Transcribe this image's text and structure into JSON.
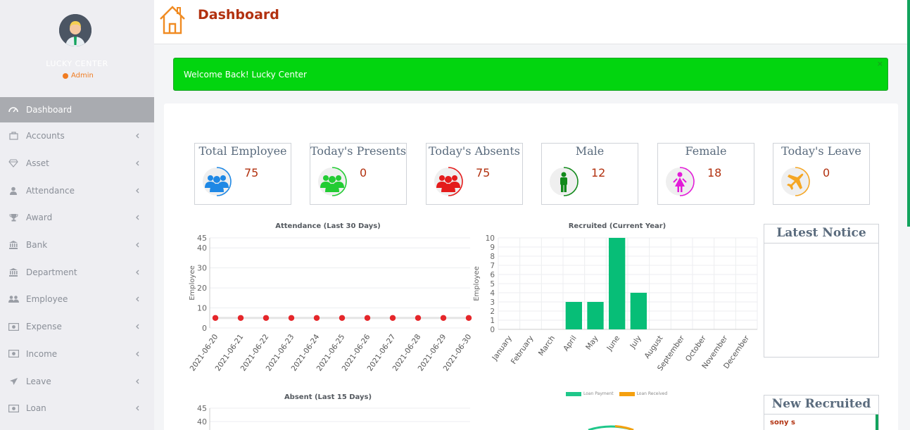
{
  "sidebar": {
    "user_name": "LUCKY CENTER",
    "user_role": "Admin",
    "items": [
      {
        "label": "Dashboard",
        "icon": "dashboard-icon",
        "active": true
      },
      {
        "label": "Accounts",
        "icon": "briefcase-icon"
      },
      {
        "label": "Asset",
        "icon": "diamond-icon"
      },
      {
        "label": "Attendance",
        "icon": "user-icon"
      },
      {
        "label": "Award",
        "icon": "trophy-icon"
      },
      {
        "label": "Bank",
        "icon": "bank-icon"
      },
      {
        "label": "Department",
        "icon": "bank-icon"
      },
      {
        "label": "Employee",
        "icon": "users-icon"
      },
      {
        "label": "Expense",
        "icon": "money-icon"
      },
      {
        "label": "Income",
        "icon": "money-icon"
      },
      {
        "label": "Leave",
        "icon": "plane-icon"
      },
      {
        "label": "Loan",
        "icon": "money-icon"
      }
    ]
  },
  "header": {
    "title": "Dashboard"
  },
  "alert": {
    "message": "Welcome Back! Lucky Center",
    "close": "×"
  },
  "stats": [
    {
      "title": "Total Employee",
      "value": "75",
      "color": "#1e88e5",
      "icon": "users-icon"
    },
    {
      "title": "Today's Presents",
      "value": "0",
      "color": "#22cc33",
      "icon": "users-icon"
    },
    {
      "title": "Today's Absents",
      "value": "75",
      "color": "#e41b1b",
      "icon": "users-icon"
    },
    {
      "title": "Male",
      "value": "12",
      "color": "#128a1b",
      "icon": "male-icon"
    },
    {
      "title": "Female",
      "value": "18",
      "color": "#e21cd8",
      "icon": "female-icon"
    },
    {
      "title": "Today's Leave",
      "value": "0",
      "color": "#f5a623",
      "icon": "plane-icon"
    }
  ],
  "notice": {
    "title": "Latest Notice"
  },
  "recruited_box": {
    "title": "New Recruited",
    "items": [
      "sony s"
    ]
  },
  "legend": {
    "items": [
      {
        "label": "Loan Payment",
        "color": "#1fc78a"
      },
      {
        "label": "Loan Received",
        "color": "#f5a00f"
      }
    ]
  },
  "chart_data": [
    {
      "type": "line",
      "title": "Attendance (Last 30 Days)",
      "ylabel": "Employee",
      "ylim": [
        0,
        45
      ],
      "yticks": [
        0,
        10,
        20,
        30,
        40,
        45
      ],
      "x": [
        "2021-06-20",
        "2021-06-21",
        "2021-06-22",
        "2021-06-23",
        "2021-06-24",
        "2021-06-25",
        "2021-06-26",
        "2021-06-27",
        "2021-06-28",
        "2021-06-29",
        "2021-06-30"
      ],
      "values": [
        5,
        5,
        5,
        5,
        5,
        5,
        5,
        5,
        5,
        5,
        5
      ],
      "color": "#e5262a"
    },
    {
      "type": "bar",
      "title": "Recruited (Current Year)",
      "ylabel": "Employee",
      "ylim": [
        0,
        10
      ],
      "yticks": [
        0,
        1,
        2,
        3,
        4,
        5,
        6,
        7,
        8,
        9,
        10
      ],
      "categories": [
        "January",
        "February",
        "March",
        "April",
        "May",
        "June",
        "July",
        "August",
        "September",
        "October",
        "November",
        "December"
      ],
      "values": [
        0,
        0,
        0,
        3,
        3,
        10,
        4,
        0,
        0,
        0,
        0,
        0
      ],
      "color": "#07be77"
    },
    {
      "type": "line",
      "title": "Absent (Last 15 Days)",
      "ylim": [
        0,
        45
      ],
      "yticks": [
        40,
        45
      ]
    }
  ]
}
